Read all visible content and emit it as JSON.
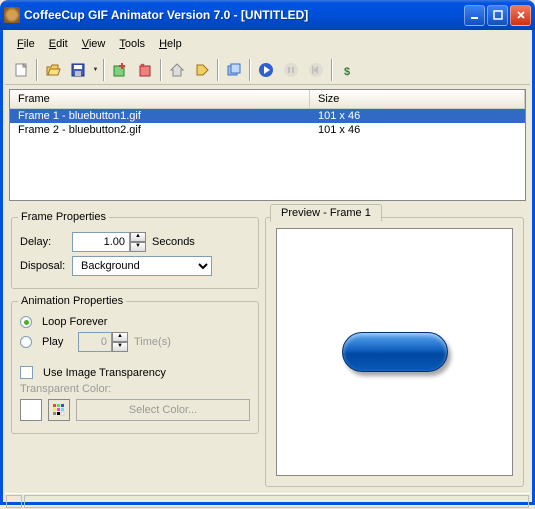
{
  "window": {
    "title": "CoffeeCup GIF Animator Version 7.0 - [UNTITLED]"
  },
  "menu": {
    "file": "File",
    "edit": "Edit",
    "view": "View",
    "tools": "Tools",
    "help": "Help"
  },
  "frame_list": {
    "col_frame": "Frame",
    "col_size": "Size",
    "rows": [
      {
        "frame": "Frame 1 - bluebutton1.gif",
        "size": "101 x 46",
        "selected": true
      },
      {
        "frame": "Frame 2 - bluebutton2.gif",
        "size": "101 x 46",
        "selected": false
      }
    ]
  },
  "frame_props": {
    "title": "Frame Properties",
    "delay_label": "Delay:",
    "delay_value": "1.00",
    "delay_unit": "Seconds",
    "disposal_label": "Disposal:",
    "disposal_value": "Background"
  },
  "anim_props": {
    "title": "Animation Properties",
    "loop_forever": "Loop Forever",
    "play": "Play",
    "play_value": "0",
    "play_unit": "Time(s)",
    "use_transparency": "Use Image Transparency",
    "transparent_label": "Transparent Color:",
    "select_color": "Select Color..."
  },
  "preview": {
    "title": "Preview - Frame 1"
  }
}
